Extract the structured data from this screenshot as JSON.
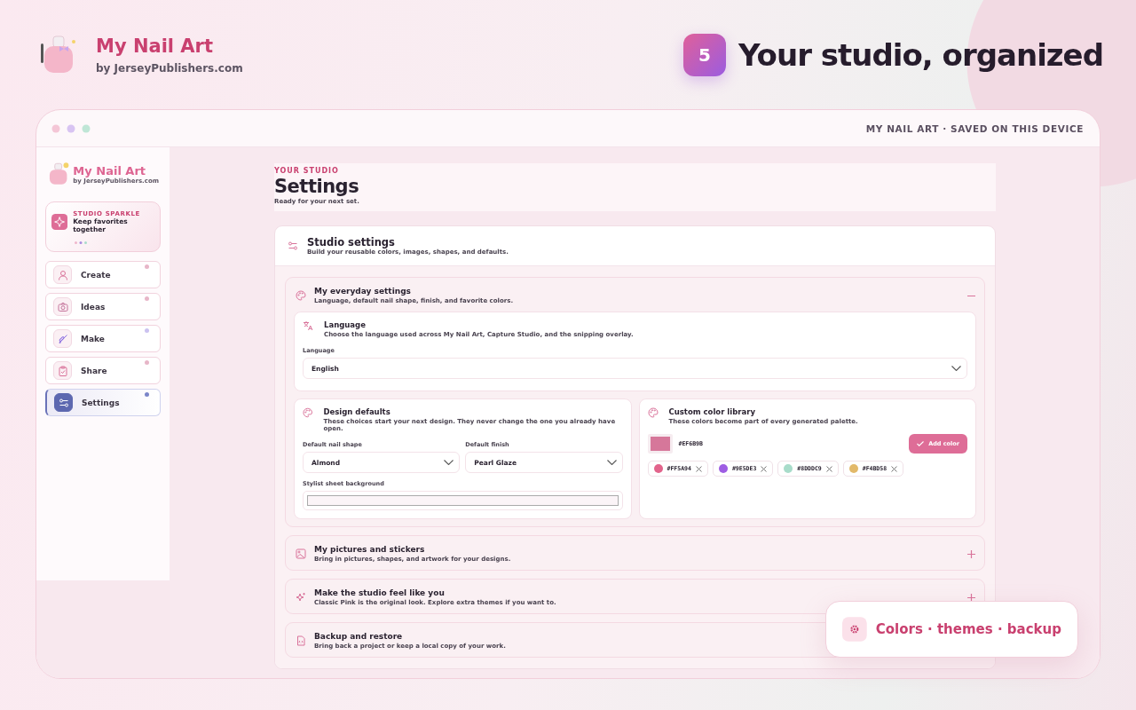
{
  "brand": {
    "name": "My Nail Art",
    "byline": "by JerseyPublishers.com"
  },
  "step": {
    "number": "5",
    "title": "Your studio, organized"
  },
  "window": {
    "status": "MY NAIL ART · SAVED ON THIS DEVICE"
  },
  "sidebar": {
    "brand": {
      "name": "My Nail Art",
      "byline": "by JerseyPublishers.com"
    },
    "promo": {
      "eyebrow": "STUDIO SPARKLE",
      "text": "Keep favorites together"
    },
    "items": [
      {
        "label": "Create",
        "kind": "person",
        "selected": false,
        "color": "#e7b6c8"
      },
      {
        "label": "Ideas",
        "kind": "camera",
        "selected": false,
        "color": "#e7b6c8"
      },
      {
        "label": "Make",
        "kind": "brush",
        "selected": false,
        "color": "#cbc2f0"
      },
      {
        "label": "Share",
        "kind": "clipboard",
        "selected": false,
        "color": "#e7b6c8"
      },
      {
        "label": "Settings",
        "kind": "sliders",
        "selected": true,
        "color": "#7b86c9"
      }
    ]
  },
  "page": {
    "eyebrow": "YOUR STUDIO",
    "title": "Settings",
    "subtitle": "Ready for your next set."
  },
  "card": {
    "title": "Studio settings",
    "subtitle": "Build your reusable colors, images, shapes, and defaults."
  },
  "sections": [
    {
      "kind": "palette",
      "title": "My everyday settings",
      "subtitle": "Language, default nail shape, finish, and favorite colors.",
      "expanded": true
    },
    {
      "kind": "image",
      "title": "My pictures and stickers",
      "subtitle": "Bring in pictures, shapes, and artwork for your designs.",
      "expanded": false
    },
    {
      "kind": "sparkle",
      "title": "Make the studio feel like you",
      "subtitle": "Classic Pink is the original look. Explore extra themes if you want to.",
      "expanded": false
    },
    {
      "kind": "file",
      "title": "Backup and restore",
      "subtitle": "Bring back a project or keep a local copy of your work.",
      "expanded": false
    }
  ],
  "language": {
    "title": "Language",
    "subtitle": "Choose the language used across My Nail Art, Capture Studio, and the snipping overlay.",
    "field_label": "Language",
    "value": "English"
  },
  "design_defaults": {
    "title": "Design defaults",
    "subtitle": "These choices start your next design. They never change the one you already have open.",
    "shape_label": "Default nail shape",
    "shape_value": "Almond",
    "finish_label": "Default finish",
    "finish_value": "Pearl Glaze",
    "background_label": "Stylist sheet background"
  },
  "color_library": {
    "title": "Custom color library",
    "subtitle": "These colors become part of every generated palette.",
    "current": {
      "label": "#EF6B9B",
      "color": "#d6779a"
    },
    "add_button": "Add color",
    "colors": [
      {
        "label": "#FF5A94",
        "color": "#e2648c"
      },
      {
        "label": "#9E5DE3",
        "color": "#9e5de3"
      },
      {
        "label": "#8DDDC9",
        "color": "#a8dcca"
      },
      {
        "label": "#F4BD58",
        "color": "#e2b96a"
      }
    ]
  },
  "callout": {
    "text": "Colors · themes · backup"
  }
}
